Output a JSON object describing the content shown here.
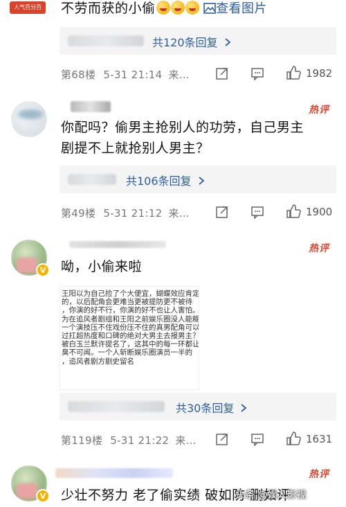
{
  "top": {
    "badge": "人气百分百",
    "comment": "不劳而获的小偷",
    "view_image": "查看图片",
    "reply_count": "共120条回复",
    "floor": "第68楼",
    "time": "5-31 21:14",
    "source": "来...",
    "likes": "1982"
  },
  "comments": [
    {
      "hot_tag": "热评",
      "text_line1": "你配吗？偷男主抢别人的功劳，自己男主",
      "text_line2": "剧提不上就抢别人男主？",
      "reply_count": "共106条回复",
      "floor": "第49楼",
      "time": "5-31 21:12",
      "source": "来...",
      "likes": "1900"
    },
    {
      "hot_tag": "热评",
      "text": "呦，小偷来啦",
      "screenshot_lines": [
        "王阳以为自己捡了个大便宜，蝴蝶效应肯定会",
        "的，以后配角会更难当更被提防更不被待",
        "，你演的好不行，你演的好不也让人害怕。",
        "为在追风者剧组和王阳之前娱乐圈没人能糊",
        "一个演技压不住戏份压不住的真男配角可以",
        "过扛超热度和口碑的绝对大男主去报男主？",
        "被白玉兰默许提名了，这其中的每一环都让",
        "臭不可闻。一个人斩断娱乐圈演员一半的",
        "，追风者剧方剧史留名"
      ],
      "reply_count": "共30条回复",
      "floor": "第119楼",
      "time": "5-31 21:22",
      "source": "来...",
      "likes": "1631"
    },
    {
      "hot_tag": "热评",
      "text": "少壮不努力 老了偷实绩 破如防 删如评"
    }
  ],
  "watermark": "头条 @娱人影视",
  "icons": [
    "share-icon",
    "comment-icon",
    "like-icon",
    "image-icon",
    "chevron-right-icon",
    "verified-badge-icon"
  ],
  "colors": {
    "link": "#2b5ea8",
    "hot": "#e0442f",
    "meta": "#777777",
    "reply_bg": "#f4f4f4"
  }
}
